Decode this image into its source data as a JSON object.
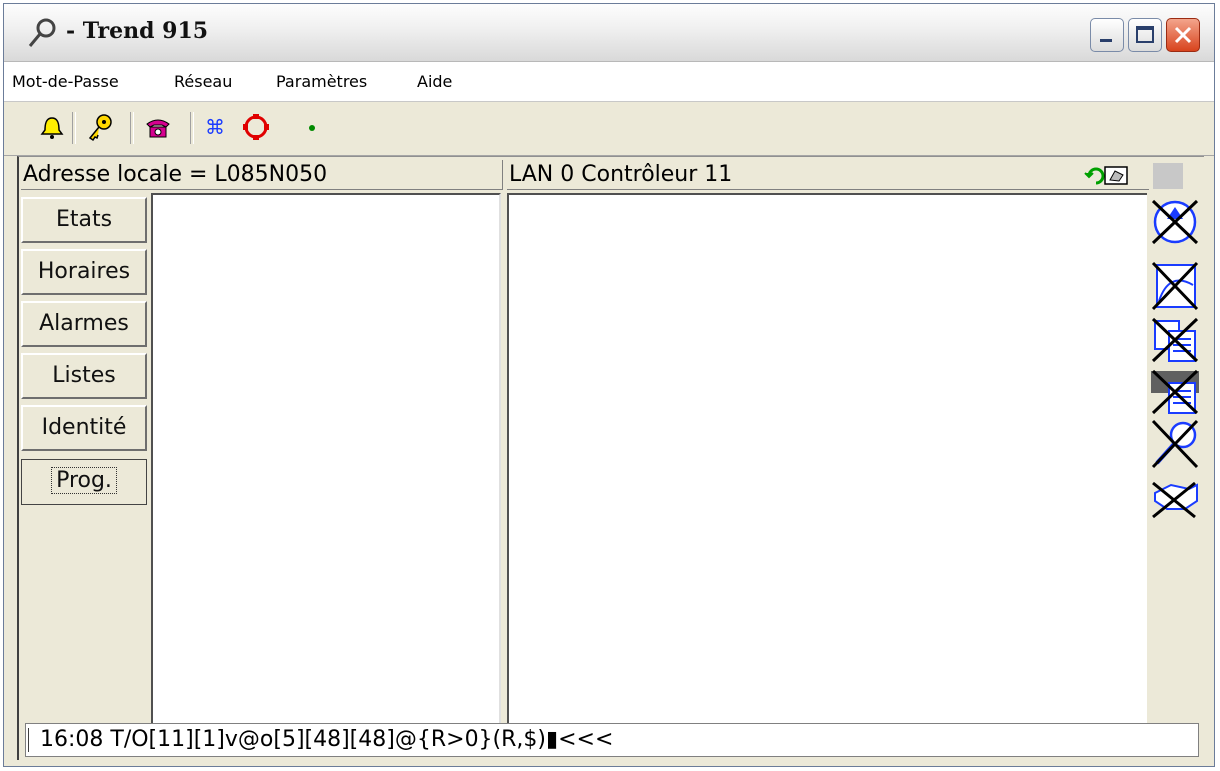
{
  "window": {
    "title": "- Trend 915"
  },
  "menu": {
    "items": [
      "Mot-de-Passe",
      "Réseau",
      "Paramètres",
      "Aide"
    ]
  },
  "toolbar": {
    "icons": [
      "bell-icon",
      "key-icon",
      "telephone-icon",
      "network-icon",
      "circle-icon",
      "dot-icon"
    ]
  },
  "header": {
    "left": "Adresse locale = L085N050",
    "right": "LAN 0 Contrôleur 11"
  },
  "sidebar": {
    "buttons": [
      "Etats",
      "Horaires",
      "Alarmes",
      "Listes",
      "Identité",
      "Prog."
    ],
    "active": "Prog."
  },
  "right_tools": [
    "upload-disabled-icon",
    "graph-disabled-icon",
    "document-disabled-icon",
    "printer-disabled-icon",
    "search-disabled-icon",
    "handshake-disabled-icon"
  ],
  "status": {
    "text": "16:08 T/O[11][1]v@o[5][48][48]@{R>0}(R,$)▮<<<"
  }
}
